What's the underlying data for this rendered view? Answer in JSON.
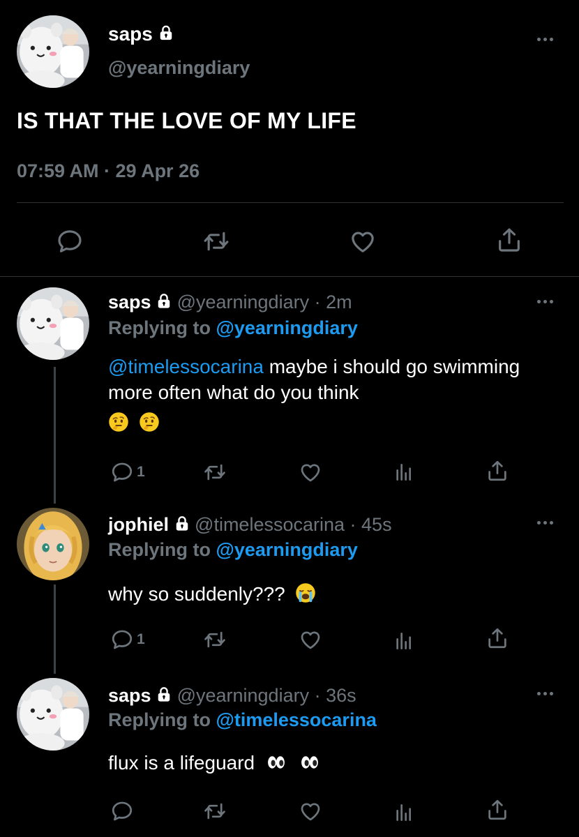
{
  "main_tweet": {
    "name": "saps",
    "handle": "@yearningdiary",
    "text": "IS THAT THE LOVE OF MY LIFE",
    "timestamp": "07:59 AM · 29 Apr 26"
  },
  "replies": [
    {
      "name": "saps",
      "handle": "@yearningdiary",
      "time": "· 2m",
      "replying_label": "Replying to",
      "replying_to": "@yearningdiary",
      "mention": "@timelessocarina",
      "text": " maybe i should go swimming more often what do you think",
      "emojis": [
        "thinking-face",
        "thinking-face"
      ],
      "reply_count": "1"
    },
    {
      "name": "jophiel",
      "handle": "@timelessocarina",
      "time": "· 45s",
      "replying_label": "Replying to",
      "replying_to": "@yearningdiary",
      "text": "why so suddenly???",
      "emojis": [
        "loudly-crying-face"
      ],
      "reply_count": "1"
    },
    {
      "name": "saps",
      "handle": "@yearningdiary",
      "time": "· 36s",
      "replying_label": "Replying to",
      "replying_to": "@timelessocarina",
      "text": "flux is a lifeguard",
      "emojis": [
        "eyes",
        "eyes"
      ],
      "reply_count": ""
    }
  ],
  "colors": {
    "background": "#000000",
    "accent": "#1d9bf0",
    "muted": "#6e767d",
    "text": "#e7e9ea"
  },
  "icons": [
    "lock-icon",
    "reply-icon",
    "retweet-icon",
    "like-icon",
    "share-icon",
    "analytics-icon",
    "more-icon"
  ]
}
